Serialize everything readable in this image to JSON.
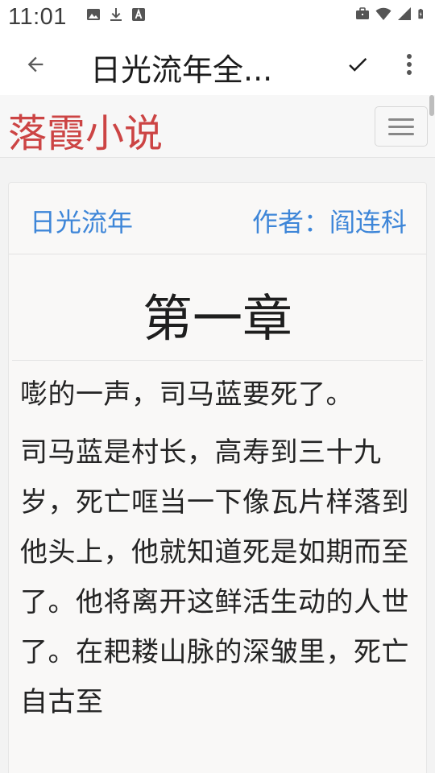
{
  "status_bar": {
    "time": "11:01",
    "left_icons": [
      "image-icon",
      "download-icon",
      "font-icon"
    ],
    "right_icons": [
      "briefcase-icon",
      "wifi-icon",
      "signal-icon",
      "battery-icon"
    ]
  },
  "app_bar": {
    "title": "日光流年全...",
    "back_icon": "arrow-left-icon",
    "done_icon": "check-icon",
    "menu_icon": "more-vert-icon"
  },
  "site": {
    "logo": "落霞小说",
    "menu_icon": "hamburger-icon",
    "logo_color": "#cc4444",
    "link_color": "#3e86d8"
  },
  "book": {
    "title": "日光流年",
    "author": "作者：阎连科"
  },
  "chapter": {
    "title": "第一章",
    "paragraphs": [
      "嘭的一声，司马蓝要死了。",
      "司马蓝是村长，高寿到三十九岁，死亡哐当一下像瓦片样落到他头上，他就知道死是如期而至了。他将离开这鲜活生动的人世了。在耙耧山脉的深皱里，死亡自古至"
    ]
  }
}
